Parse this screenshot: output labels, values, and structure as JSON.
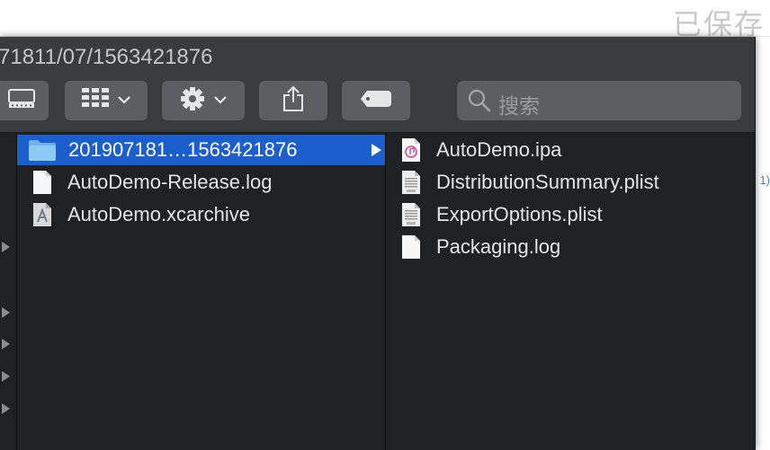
{
  "background": {
    "top_text": "已保存",
    "side_fragment": "1)"
  },
  "window": {
    "title": "71811/07/1563421876"
  },
  "toolbar": {
    "buttons": [
      {
        "name": "view-toggle",
        "icon": "display-icon"
      },
      {
        "name": "view-options",
        "icon": "grid-icon",
        "has_chevron": true
      },
      {
        "name": "action",
        "icon": "gear-icon",
        "has_chevron": true
      },
      {
        "name": "share",
        "icon": "share-icon"
      },
      {
        "name": "tags",
        "icon": "tag-icon"
      }
    ],
    "search_placeholder": "搜索"
  },
  "column1": {
    "items": [
      {
        "label": "201907181…1563421876",
        "icon": "folder-icon",
        "selected": true
      },
      {
        "label": "AutoDemo-Release.log",
        "icon": "document-icon"
      },
      {
        "label": "AutoDemo.xcarchive",
        "icon": "archive-icon"
      }
    ]
  },
  "column2": {
    "items": [
      {
        "label": "AutoDemo.ipa",
        "icon": "ipa-icon"
      },
      {
        "label": "DistributionSummary.plist",
        "icon": "plist-icon"
      },
      {
        "label": "ExportOptions.plist",
        "icon": "plist-icon"
      },
      {
        "label": "Packaging.log",
        "icon": "document-icon"
      }
    ]
  },
  "colors": {
    "selection": "#1c5ecc",
    "window_bg": "#1f2123",
    "toolbar_bg": "#3a3b3d"
  }
}
